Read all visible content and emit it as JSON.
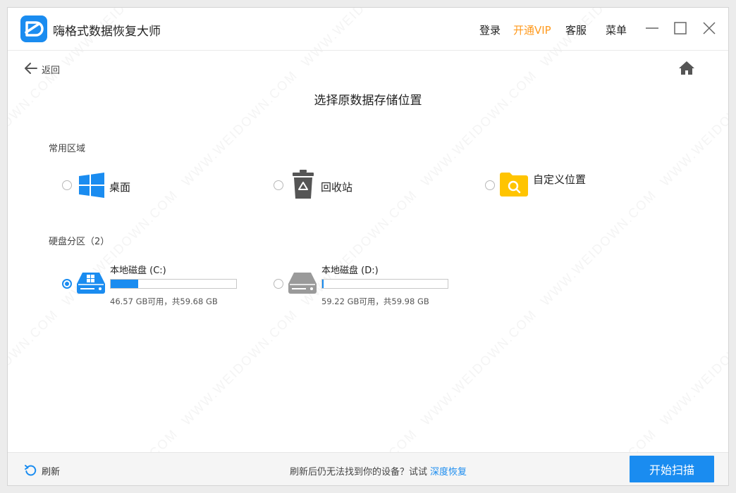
{
  "app": {
    "title": "嗨格式数据恢复大师"
  },
  "titlebar": {
    "login": "登录",
    "vip": "开通VIP",
    "service": "客服",
    "menu": "菜单"
  },
  "nav": {
    "back_label": "返回"
  },
  "page": {
    "title": "选择原数据存储位置"
  },
  "common_section": {
    "label": "常用区域",
    "items": [
      {
        "label": "桌面",
        "icon": "windows-icon",
        "selected": false
      },
      {
        "label": "回收站",
        "icon": "recycle-bin-icon",
        "selected": false
      },
      {
        "label": "自定义位置",
        "icon": "folder-search-icon",
        "selected": false
      }
    ]
  },
  "disk_section": {
    "label": "硬盘分区（2）",
    "drives": [
      {
        "name": "本地磁盘 (C:)",
        "info": "46.57 GB可用，共59.68 GB",
        "used_fraction": 0.22,
        "selected": true,
        "icon": "system-drive-icon"
      },
      {
        "name": "本地磁盘 (D:)",
        "info": "59.22 GB可用，共59.98 GB",
        "used_fraction": 0.01,
        "selected": false,
        "icon": "drive-icon"
      }
    ]
  },
  "footer": {
    "refresh_label": "刷新",
    "hint_text": "刷新后仍无法找到你的设备？试试",
    "hint_link": "深度恢复",
    "start_button": "开始扫描"
  },
  "colors": {
    "accent": "#1a8cf0",
    "vip": "#ff9a1e",
    "folder": "#ffc400"
  }
}
